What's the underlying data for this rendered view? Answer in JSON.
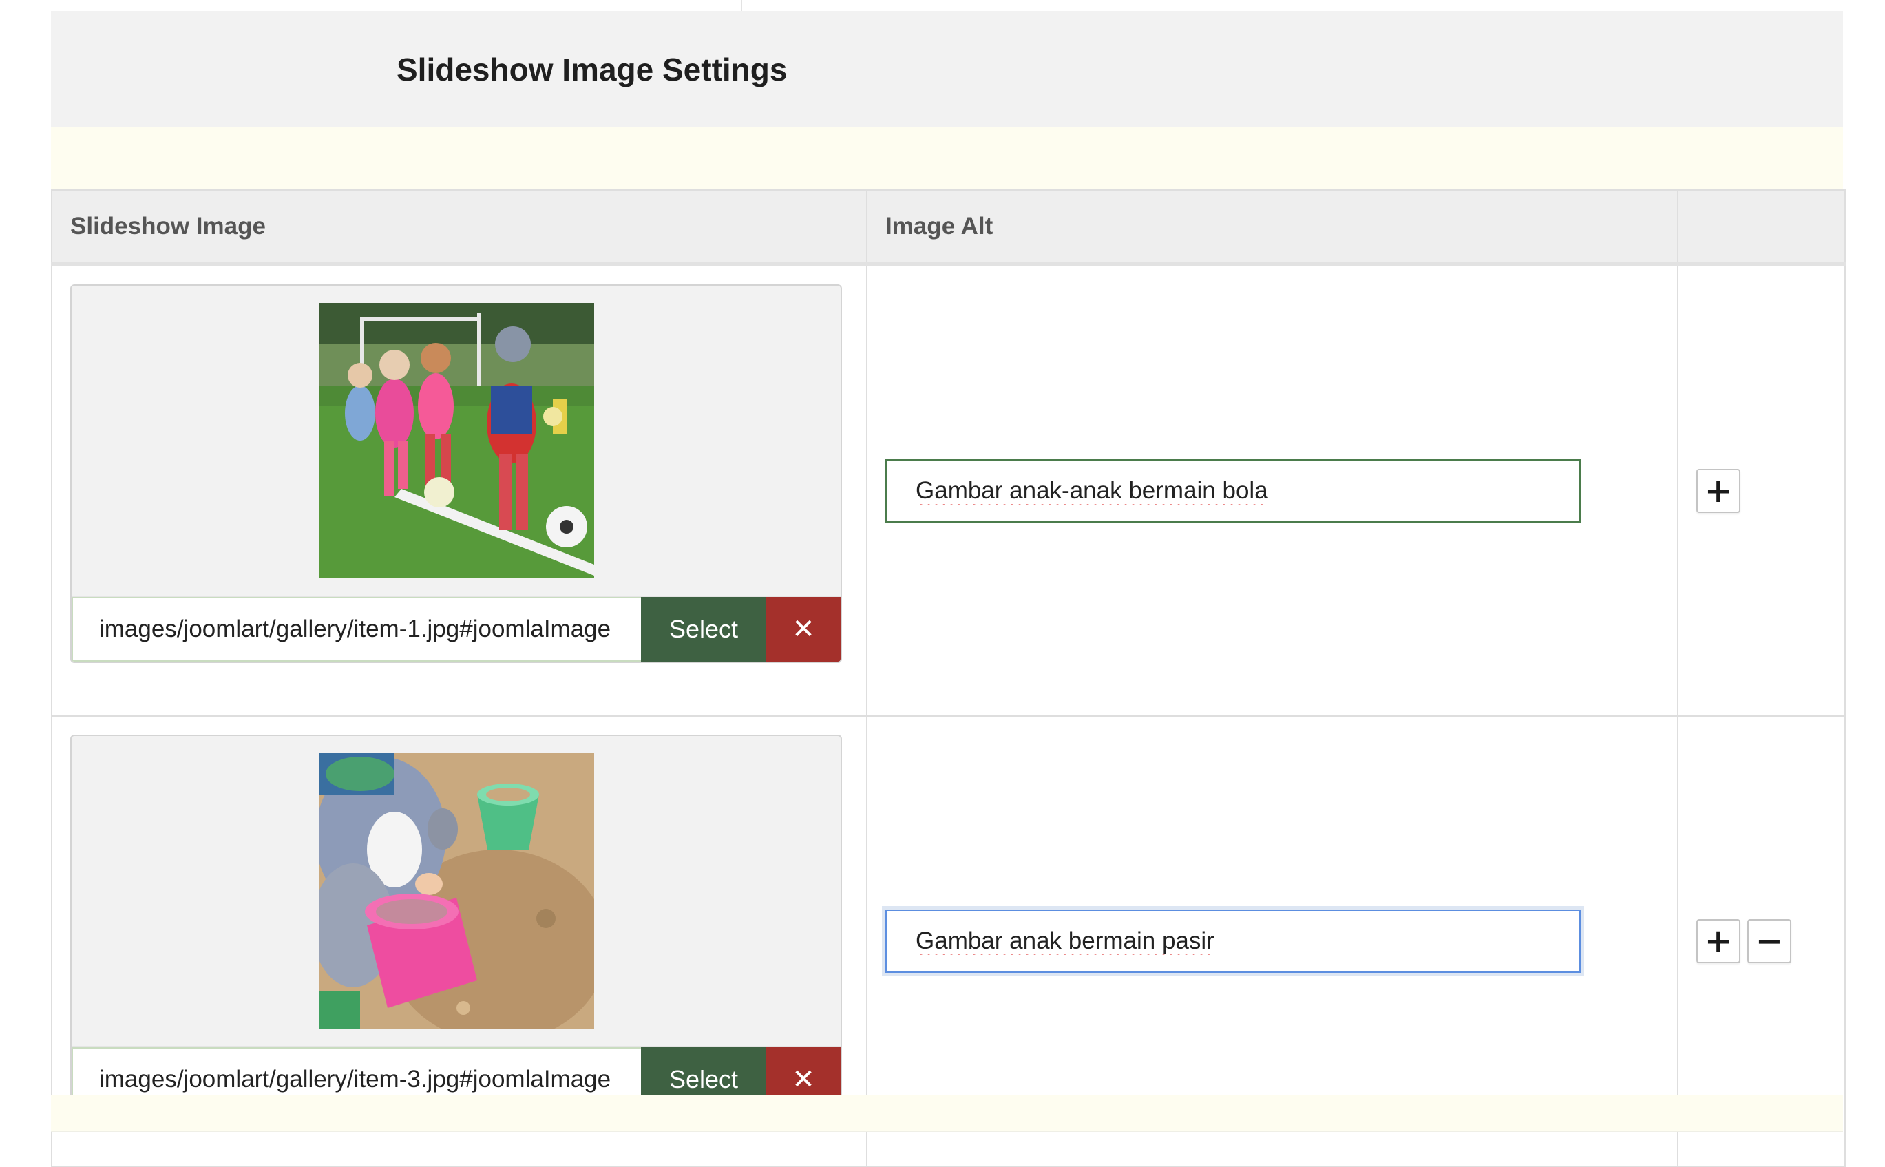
{
  "page": {
    "title": "Slideshow Image Settings"
  },
  "table": {
    "headers": {
      "image": "Slideshow Image",
      "alt": "Image Alt",
      "actions": ""
    },
    "rows": [
      {
        "image_path": "images/joomlart/gallery/item-1.jpg#joomlaImage",
        "image_description": "children playing football on grass field",
        "select_label": "Select",
        "clear_label": "✕",
        "alt_text": "Gambar anak-anak bermain bola",
        "add_label": "+",
        "remove_label": ""
      },
      {
        "image_path": "images/joomlart/gallery/item-3.jpg#joomlaImage",
        "image_description": "child playing with buckets in sand",
        "select_label": "Select",
        "clear_label": "✕",
        "alt_text": "Gambar anak bermain pasir",
        "add_label": "+",
        "remove_label": "−"
      }
    ]
  },
  "colors": {
    "select_button": "#3e6142",
    "clear_button": "#a4302b",
    "header_band": "#f2f2f2",
    "notice_band": "#fefdf0",
    "focus_border": "#5c8ee0",
    "valid_border": "#4b7c4c"
  },
  "icons": {
    "clear": "close-icon",
    "add": "plus-icon",
    "remove": "minus-icon"
  }
}
